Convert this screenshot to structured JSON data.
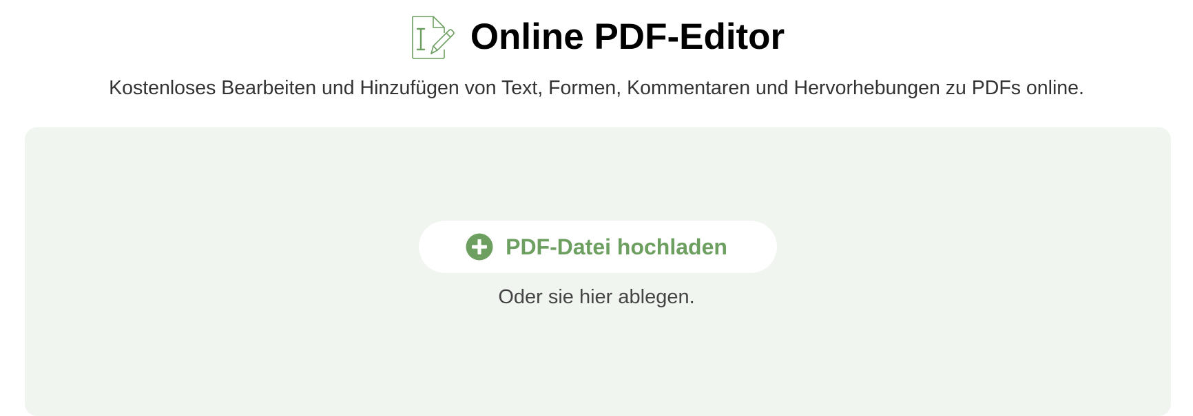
{
  "header": {
    "title": "Online PDF-Editor",
    "subtitle": "Kostenloses Bearbeiten und Hinzufügen von Text, Formen, Kommentaren und Hervorhebungen zu PDFs online.",
    "icon": "pdf-edit-icon"
  },
  "dropzone": {
    "upload_label": "PDF-Datei hochladen",
    "upload_icon": "plus-circle-icon",
    "drop_hint": "Oder sie hier ablegen."
  },
  "colors": {
    "accent": "#6c9f60",
    "dropzone_bg": "#f0f5ef",
    "button_bg": "#ffffff",
    "title": "#000000",
    "text": "#333333"
  }
}
